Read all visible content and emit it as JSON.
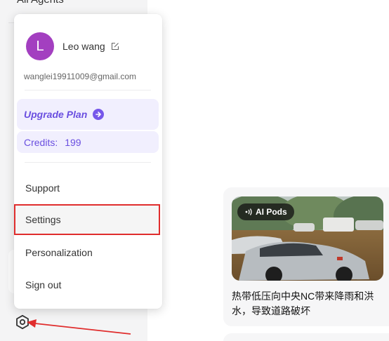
{
  "sidebar": {
    "top_item_label": "All Agents"
  },
  "menu": {
    "avatar_letter": "L",
    "user_name": "Leo wang",
    "email": "wanglei19911009@gmail.com",
    "upgrade_label": "Upgrade Plan",
    "credits_label": "Credits:",
    "credits_value": "199",
    "items": [
      {
        "label": "Support"
      },
      {
        "label": "Settings"
      },
      {
        "label": "Personalization"
      },
      {
        "label": "Sign out"
      }
    ]
  },
  "news": {
    "badge": "AI Pods",
    "title": "热带低压向中央NC带来降雨和洪水，导致道路破坏"
  },
  "colors": {
    "accent": "#6a4fe0",
    "avatar": "#a33fc0",
    "highlight": "#e02d2d"
  }
}
